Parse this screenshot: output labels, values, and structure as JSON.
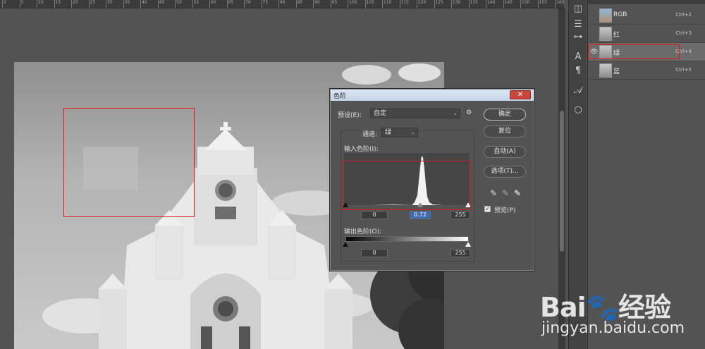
{
  "ruler": {
    "ticks": [
      "0",
      "5",
      "10",
      "15",
      "20",
      "25",
      "30",
      "35",
      "40",
      "45",
      "50",
      "55",
      "60",
      "65",
      "70",
      "75",
      "80",
      "85",
      "90",
      "95",
      "100",
      "105",
      "110",
      "115",
      "120",
      "125",
      "130",
      "135",
      "140",
      "145",
      "150",
      "155",
      "160"
    ]
  },
  "channels": {
    "items": [
      {
        "label": "RGB",
        "shortcut": "Ctrl+2",
        "visible": true,
        "selected": false
      },
      {
        "label": "红",
        "shortcut": "Ctrl+3",
        "visible": false,
        "selected": false
      },
      {
        "label": "绿",
        "shortcut": "Ctrl+4",
        "visible": true,
        "selected": true
      },
      {
        "label": "蓝",
        "shortcut": "Ctrl+5",
        "visible": false,
        "selected": false
      }
    ]
  },
  "levels_dialog": {
    "title": "色阶",
    "close_glyph": "✕",
    "preset_label": "预设(E):",
    "preset_value": "自定",
    "channel_label": "通道:",
    "channel_value": "绿",
    "input_levels_label": "输入色阶(I):",
    "input_black": "0",
    "input_gamma": "0.72",
    "input_white": "255",
    "output_levels_label": "输出色阶(O):",
    "output_black": "0",
    "output_white": "255",
    "buttons": {
      "ok": "确定",
      "reset": "复位",
      "auto": "自动(A)",
      "options": "选项(T)..."
    },
    "preview_label": "预览(P)",
    "preview_checked": true
  },
  "watermark": {
    "brand": "Bai🐾经验",
    "url": "jingyan.baidu.com"
  },
  "colors": {
    "annotation": "#e01515",
    "dialog_bg": "#535353",
    "title_bar": "#c4d4e8",
    "gamma_highlight": "#3e6ab4"
  }
}
